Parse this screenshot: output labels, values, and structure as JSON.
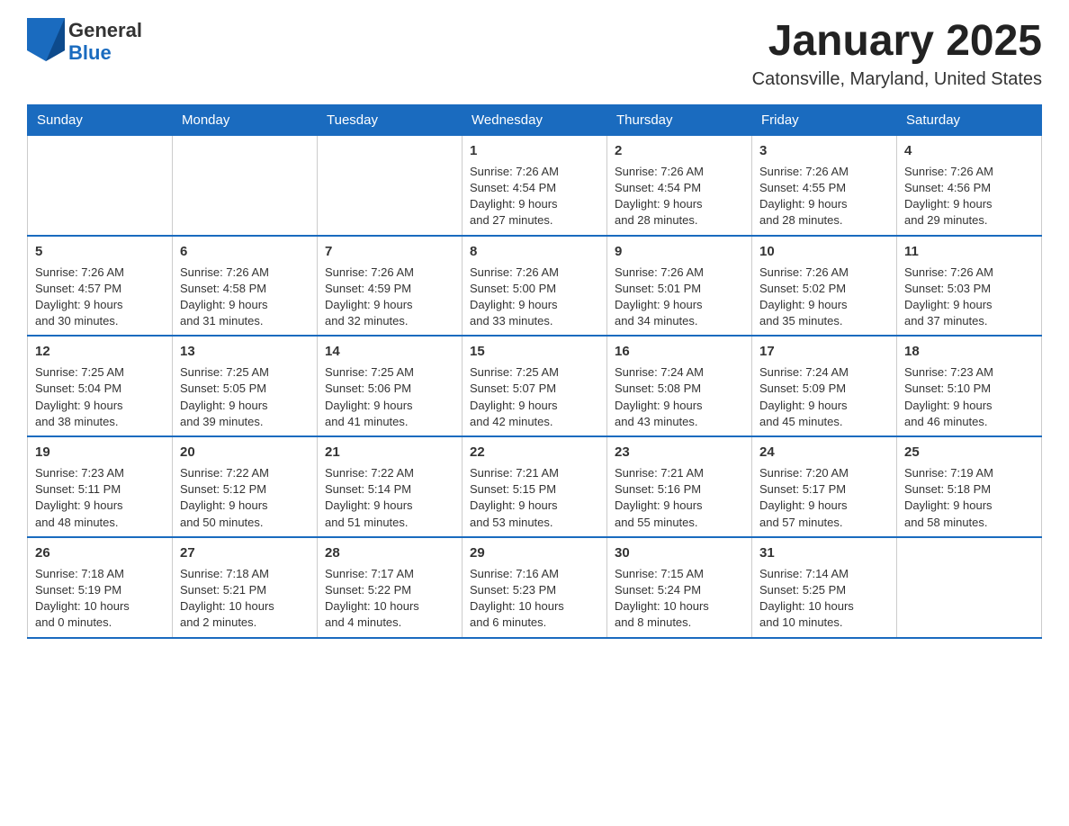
{
  "logo": {
    "general": "General",
    "blue": "Blue"
  },
  "title": "January 2025",
  "location": "Catonsville, Maryland, United States",
  "days_header": [
    "Sunday",
    "Monday",
    "Tuesday",
    "Wednesday",
    "Thursday",
    "Friday",
    "Saturday"
  ],
  "weeks": [
    [
      {
        "day": "",
        "info": ""
      },
      {
        "day": "",
        "info": ""
      },
      {
        "day": "",
        "info": ""
      },
      {
        "day": "1",
        "info": "Sunrise: 7:26 AM\nSunset: 4:54 PM\nDaylight: 9 hours\nand 27 minutes."
      },
      {
        "day": "2",
        "info": "Sunrise: 7:26 AM\nSunset: 4:54 PM\nDaylight: 9 hours\nand 28 minutes."
      },
      {
        "day": "3",
        "info": "Sunrise: 7:26 AM\nSunset: 4:55 PM\nDaylight: 9 hours\nand 28 minutes."
      },
      {
        "day": "4",
        "info": "Sunrise: 7:26 AM\nSunset: 4:56 PM\nDaylight: 9 hours\nand 29 minutes."
      }
    ],
    [
      {
        "day": "5",
        "info": "Sunrise: 7:26 AM\nSunset: 4:57 PM\nDaylight: 9 hours\nand 30 minutes."
      },
      {
        "day": "6",
        "info": "Sunrise: 7:26 AM\nSunset: 4:58 PM\nDaylight: 9 hours\nand 31 minutes."
      },
      {
        "day": "7",
        "info": "Sunrise: 7:26 AM\nSunset: 4:59 PM\nDaylight: 9 hours\nand 32 minutes."
      },
      {
        "day": "8",
        "info": "Sunrise: 7:26 AM\nSunset: 5:00 PM\nDaylight: 9 hours\nand 33 minutes."
      },
      {
        "day": "9",
        "info": "Sunrise: 7:26 AM\nSunset: 5:01 PM\nDaylight: 9 hours\nand 34 minutes."
      },
      {
        "day": "10",
        "info": "Sunrise: 7:26 AM\nSunset: 5:02 PM\nDaylight: 9 hours\nand 35 minutes."
      },
      {
        "day": "11",
        "info": "Sunrise: 7:26 AM\nSunset: 5:03 PM\nDaylight: 9 hours\nand 37 minutes."
      }
    ],
    [
      {
        "day": "12",
        "info": "Sunrise: 7:25 AM\nSunset: 5:04 PM\nDaylight: 9 hours\nand 38 minutes."
      },
      {
        "day": "13",
        "info": "Sunrise: 7:25 AM\nSunset: 5:05 PM\nDaylight: 9 hours\nand 39 minutes."
      },
      {
        "day": "14",
        "info": "Sunrise: 7:25 AM\nSunset: 5:06 PM\nDaylight: 9 hours\nand 41 minutes."
      },
      {
        "day": "15",
        "info": "Sunrise: 7:25 AM\nSunset: 5:07 PM\nDaylight: 9 hours\nand 42 minutes."
      },
      {
        "day": "16",
        "info": "Sunrise: 7:24 AM\nSunset: 5:08 PM\nDaylight: 9 hours\nand 43 minutes."
      },
      {
        "day": "17",
        "info": "Sunrise: 7:24 AM\nSunset: 5:09 PM\nDaylight: 9 hours\nand 45 minutes."
      },
      {
        "day": "18",
        "info": "Sunrise: 7:23 AM\nSunset: 5:10 PM\nDaylight: 9 hours\nand 46 minutes."
      }
    ],
    [
      {
        "day": "19",
        "info": "Sunrise: 7:23 AM\nSunset: 5:11 PM\nDaylight: 9 hours\nand 48 minutes."
      },
      {
        "day": "20",
        "info": "Sunrise: 7:22 AM\nSunset: 5:12 PM\nDaylight: 9 hours\nand 50 minutes."
      },
      {
        "day": "21",
        "info": "Sunrise: 7:22 AM\nSunset: 5:14 PM\nDaylight: 9 hours\nand 51 minutes."
      },
      {
        "day": "22",
        "info": "Sunrise: 7:21 AM\nSunset: 5:15 PM\nDaylight: 9 hours\nand 53 minutes."
      },
      {
        "day": "23",
        "info": "Sunrise: 7:21 AM\nSunset: 5:16 PM\nDaylight: 9 hours\nand 55 minutes."
      },
      {
        "day": "24",
        "info": "Sunrise: 7:20 AM\nSunset: 5:17 PM\nDaylight: 9 hours\nand 57 minutes."
      },
      {
        "day": "25",
        "info": "Sunrise: 7:19 AM\nSunset: 5:18 PM\nDaylight: 9 hours\nand 58 minutes."
      }
    ],
    [
      {
        "day": "26",
        "info": "Sunrise: 7:18 AM\nSunset: 5:19 PM\nDaylight: 10 hours\nand 0 minutes."
      },
      {
        "day": "27",
        "info": "Sunrise: 7:18 AM\nSunset: 5:21 PM\nDaylight: 10 hours\nand 2 minutes."
      },
      {
        "day": "28",
        "info": "Sunrise: 7:17 AM\nSunset: 5:22 PM\nDaylight: 10 hours\nand 4 minutes."
      },
      {
        "day": "29",
        "info": "Sunrise: 7:16 AM\nSunset: 5:23 PM\nDaylight: 10 hours\nand 6 minutes."
      },
      {
        "day": "30",
        "info": "Sunrise: 7:15 AM\nSunset: 5:24 PM\nDaylight: 10 hours\nand 8 minutes."
      },
      {
        "day": "31",
        "info": "Sunrise: 7:14 AM\nSunset: 5:25 PM\nDaylight: 10 hours\nand 10 minutes."
      },
      {
        "day": "",
        "info": ""
      }
    ]
  ]
}
